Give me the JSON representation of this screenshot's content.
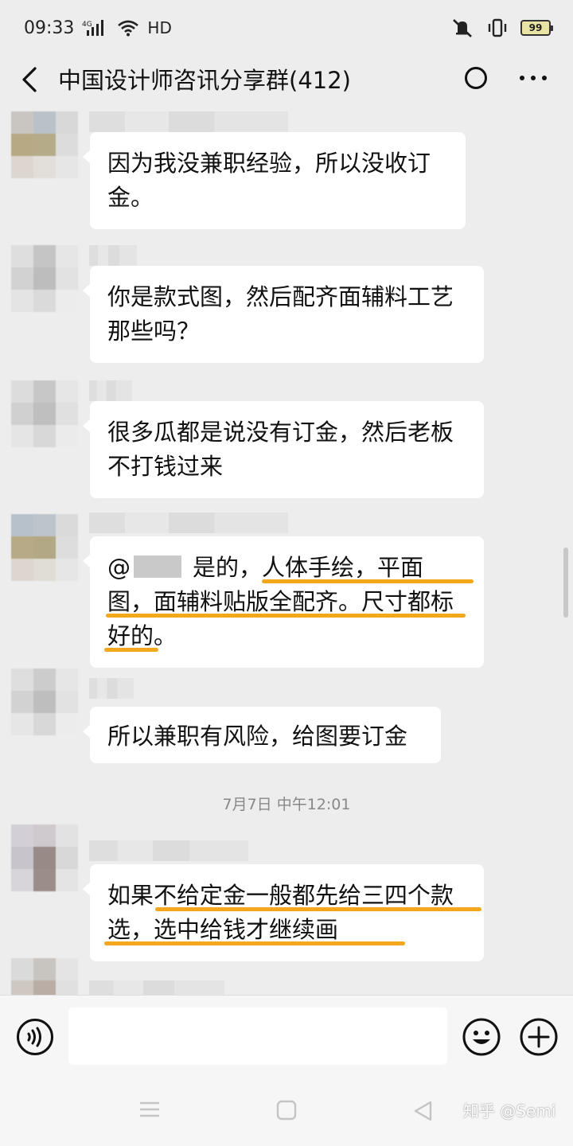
{
  "status_bar": {
    "time": "09:33",
    "network": "4G",
    "hd": "HD",
    "battery": "99"
  },
  "nav": {
    "title": "中国设计师咨讯分享群(412)"
  },
  "messages": [
    {
      "text": "因为我没兼职经验，所以没收订金。"
    },
    {
      "text": "你是款式图，然后配齐面辅料工艺那些吗？"
    },
    {
      "text": "很多瓜都是说没有订金，然后老板不打钱过来"
    },
    {
      "mention": "@",
      "text": "是的，人体手绘，平面图，面辅料贴版全配齐。尺寸都标好的。"
    },
    {
      "text": "所以兼职有风险，给图要订金"
    },
    {
      "text": "如果不给定金一般都先给三四个款选，选中给钱才继续画"
    }
  ],
  "timestamp": "7月7日 中午12:01",
  "colors": {
    "background": "#ededed",
    "bubble": "#ffffff",
    "highlight_underline": "#f3a71c"
  },
  "watermark": "知乎 @Semi"
}
